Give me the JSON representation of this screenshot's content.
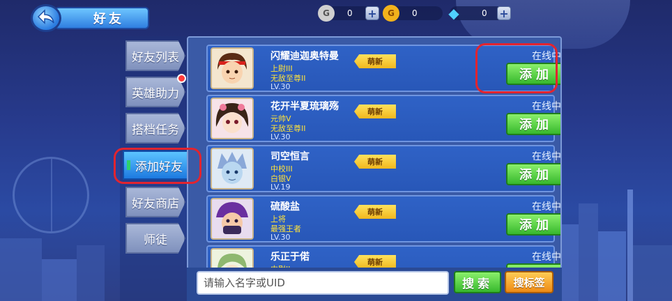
{
  "header": {
    "title": "好友",
    "back_icon": "back-arrow-icon"
  },
  "currencies": [
    {
      "icon": "silver-coin-icon",
      "symbol": "G",
      "amount": "0",
      "color": "#c9c9c9"
    },
    {
      "icon": "gold-coin-icon",
      "symbol": "G",
      "amount": "0",
      "color": "#f2b21c"
    },
    {
      "icon": "diamond-icon",
      "symbol": "◆",
      "amount": "0",
      "color": "#4fd0ff"
    }
  ],
  "tabs": [
    {
      "label": "好友列表",
      "active": false
    },
    {
      "label": "英雄助力",
      "active": false,
      "badge": true
    },
    {
      "label": "搭档任务",
      "active": false
    },
    {
      "label": "添加好友",
      "active": true
    },
    {
      "label": "好友商店",
      "active": false
    },
    {
      "label": "师徒",
      "active": false
    }
  ],
  "friends": [
    {
      "name": "闪耀迪迦奥特曼",
      "rank": "上尉III",
      "tier": "无敌至尊II",
      "level": "LV.30",
      "tag": "萌新",
      "status": "在线中",
      "action": "添加"
    },
    {
      "name": "花开半夏琉璃殇",
      "rank": "元帅V",
      "tier": "无敌至尊II",
      "level": "LV.30",
      "tag": "萌新",
      "status": "在线中",
      "action": "添加"
    },
    {
      "name": "司空恒言",
      "rank": "中校III",
      "tier": "白银V",
      "level": "LV.19",
      "tag": "萌新",
      "status": "在线中",
      "action": "添加"
    },
    {
      "name": "硫酸盐",
      "rank": "上将",
      "tier": "最强王者",
      "level": "LV.30",
      "tag": "萌新",
      "status": "在线中",
      "action": "添加"
    },
    {
      "name": "乐正于偌",
      "rank": "中尉II",
      "tier": "",
      "level": "",
      "tag": "萌新",
      "status": "在线中",
      "action": "添加"
    }
  ],
  "search": {
    "placeholder": "请输入名字或UID",
    "value": "",
    "search_label": "搜索",
    "tag_search_label": "搜标签"
  },
  "colors": {
    "highlight_outline": "#e2242f",
    "add_button": "#37b82d",
    "rank_text": "#ffe23a"
  }
}
